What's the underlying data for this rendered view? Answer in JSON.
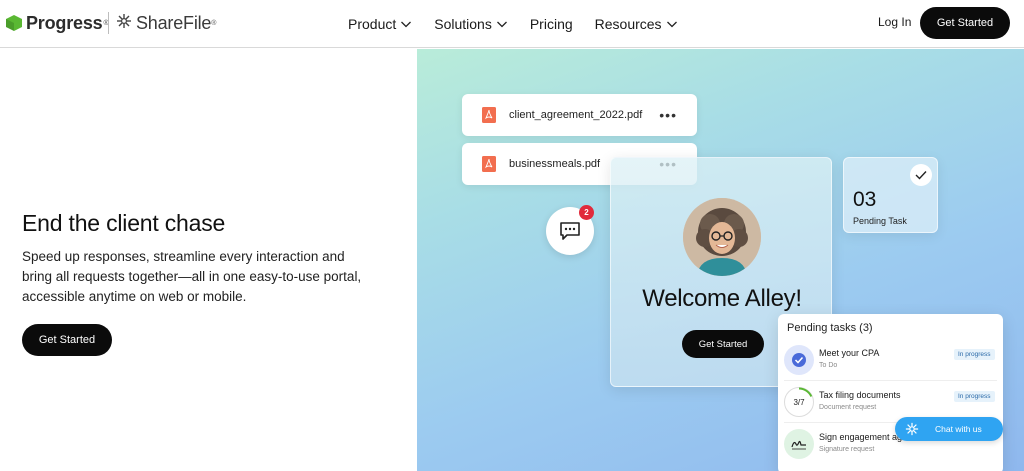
{
  "brand": {
    "progress": "Progress",
    "sharefile": "ShareFile"
  },
  "nav": {
    "items": [
      {
        "label": "Product",
        "has_menu": true
      },
      {
        "label": "Solutions",
        "has_menu": true
      },
      {
        "label": "Pricing",
        "has_menu": false
      },
      {
        "label": "Resources",
        "has_menu": true
      }
    ],
    "login": "Log In",
    "cta": "Get Started"
  },
  "hero": {
    "title": "End the client chase",
    "subtitle": "Speed up responses, streamline every interaction and bring all requests together—all in one easy-to-use portal, accessible anytime on web or mobile.",
    "cta": "Get Started"
  },
  "visual": {
    "files": [
      {
        "name": "client_agreement_2022.pdf",
        "menu": "•••"
      },
      {
        "name": "businessmeals.pdf",
        "menu": "•••"
      }
    ],
    "chat_badge": "2",
    "welcome": {
      "title": "Welcome Alley!",
      "cta": "Get Started"
    },
    "pending": {
      "count": "03",
      "label": "Pending Task"
    },
    "tasks": {
      "title": "Pending tasks (3)",
      "items": [
        {
          "title": "Meet your  CPA",
          "subtitle": "To Do",
          "status": "In progress",
          "icon": "check-icon"
        },
        {
          "title": "Tax filing documents",
          "subtitle": "Document request",
          "status": "In progress",
          "progress": "3/7",
          "icon": "progress-ring-icon"
        },
        {
          "title": "Sign engagement ag",
          "subtitle": "Signature request",
          "icon": "signature-icon"
        }
      ]
    },
    "chat_us": "Chat with us"
  },
  "colors": {
    "accent_green": "#5ab833",
    "cta_black": "#0b0b0b",
    "chat_blue": "#2fa4f2",
    "badge_red": "#e12b3c",
    "pdf_orange": "#f26e4f"
  }
}
